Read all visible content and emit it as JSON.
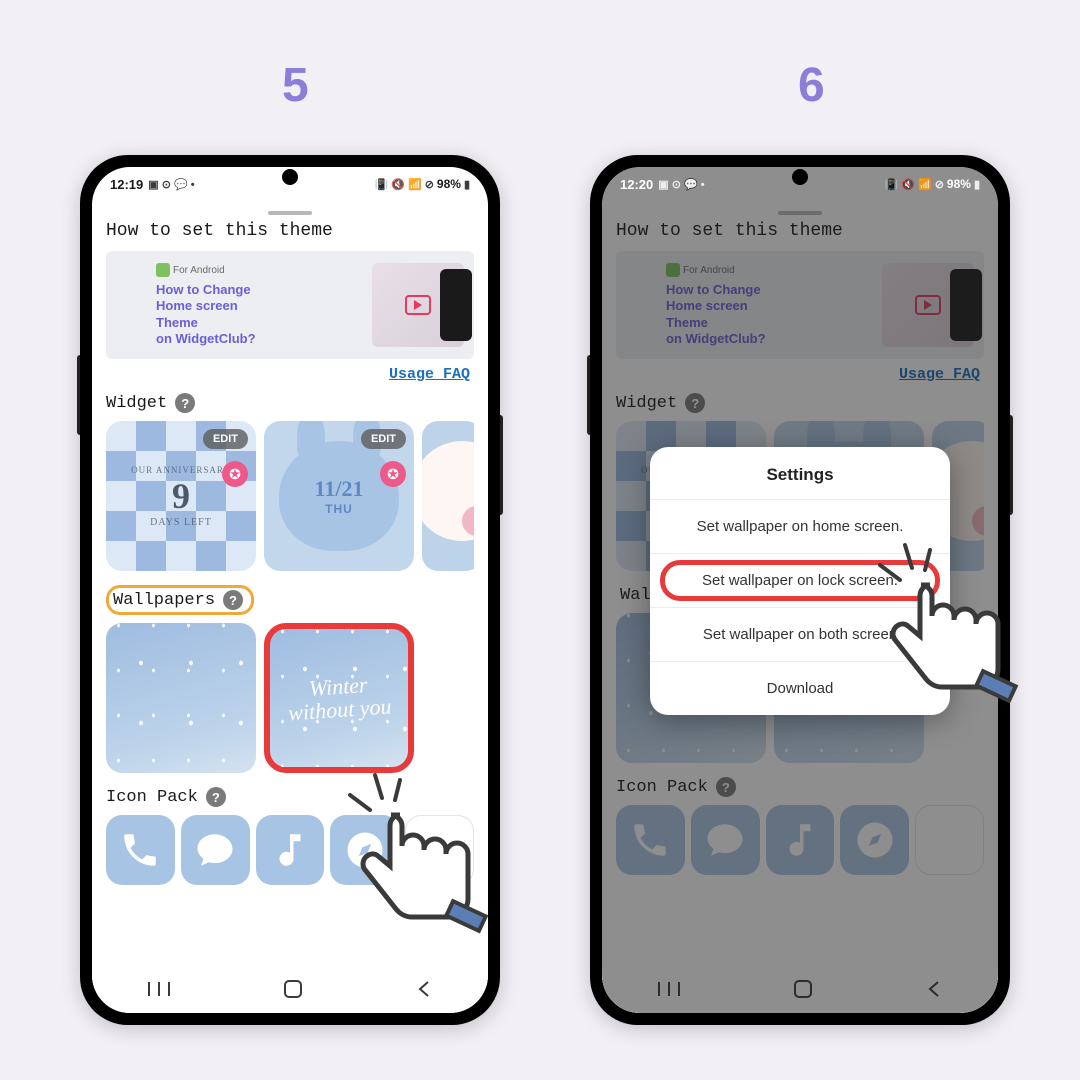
{
  "steps": {
    "left": "5",
    "right": "6"
  },
  "status": {
    "time_left": "12:19",
    "time_right": "12:20",
    "battery": "98%"
  },
  "sheet": {
    "title": "How to set this theme",
    "banner_badge": "For Android",
    "banner_title_l1": "How to Change",
    "banner_title_l2": "Home screen",
    "banner_title_l3": "Theme",
    "banner_title_l4": "on WidgetClub?",
    "faq": "Usage FAQ"
  },
  "sections": {
    "widget": "Widget",
    "wallpapers": "Wallpapers",
    "iconpack": "Icon Pack"
  },
  "widgets": {
    "card1_top": "OUR ANNIVERSARY",
    "card1_num": "9",
    "card1_bottom": "DAYS LEFT",
    "card2_date": "11/21",
    "card2_day": "THU",
    "edit_label": "EDIT"
  },
  "wallpapers": {
    "card2_line1": "Winter",
    "card2_line2": "without you"
  },
  "dialog": {
    "title": "Settings",
    "opt1": "Set wallpaper on home screen.",
    "opt2": "Set wallpaper on lock screen.",
    "opt3": "Set wallpaper on both screen",
    "opt4": "Download"
  },
  "icons": {
    "phone": "phone-icon",
    "chat": "chat-icon",
    "music": "music-icon",
    "compass": "compass-icon"
  }
}
